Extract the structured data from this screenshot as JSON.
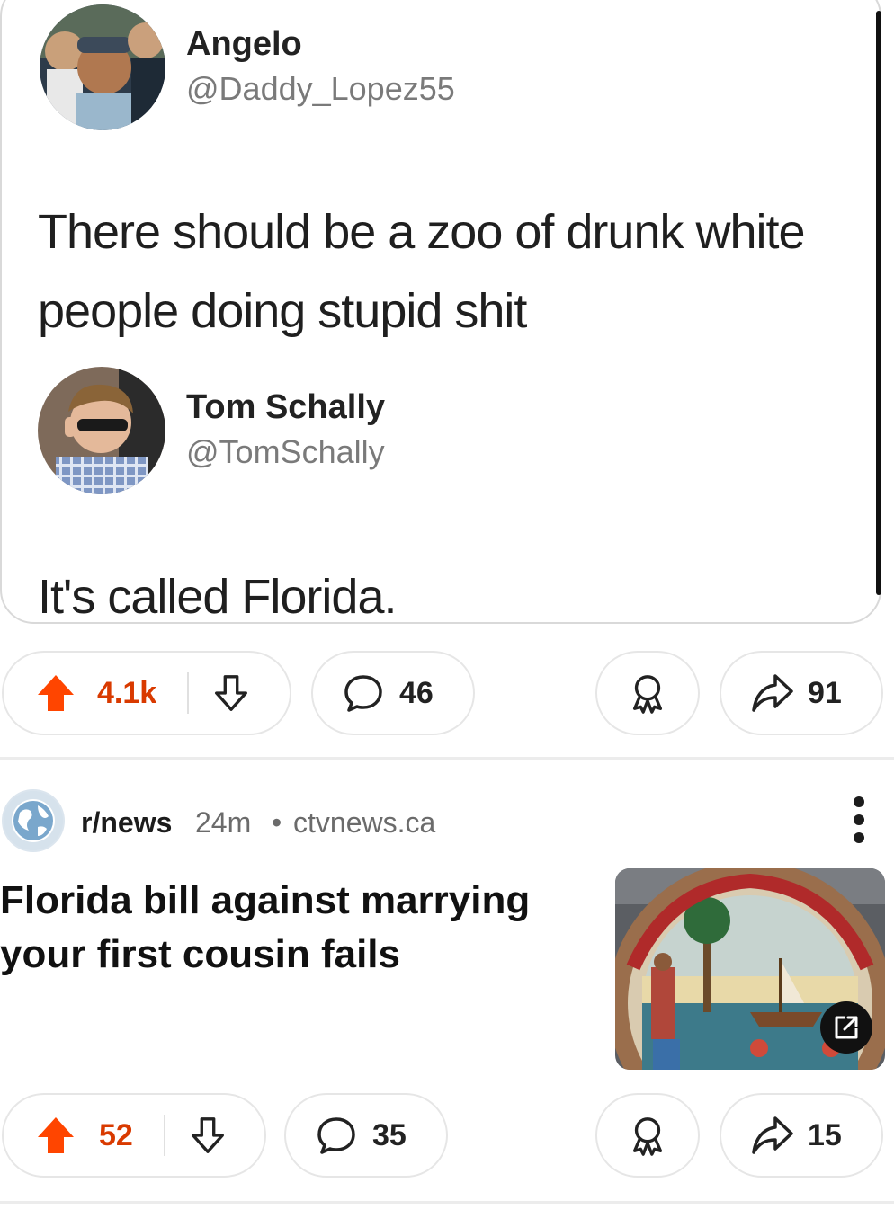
{
  "post1": {
    "tweet": {
      "author": {
        "name": "Angelo",
        "handle": "@Daddy_Lopez55"
      },
      "text_line1": "There should be a zoo of drunk white",
      "text_line2": "people doing stupid shit",
      "reply": {
        "name": "Tom Schally",
        "handle": "@TomSchally",
        "text": "It's called Florida."
      }
    },
    "actions": {
      "upvotes": "4.1k",
      "comments": "46",
      "shares": "91"
    }
  },
  "post2": {
    "subreddit": "r/news",
    "age": "24m",
    "dot": "•",
    "domain": "ctvnews.ca",
    "title_line1": "Florida bill against marrying",
    "title_line2": "your first cousin fails",
    "actions": {
      "upvotes": "52",
      "comments": "35",
      "shares": "15"
    }
  },
  "colors": {
    "upvote_active": "#ff4500",
    "upvote_count": "#d93a00",
    "border": "#e6e6e6"
  },
  "icons": [
    "upvote-arrow-icon",
    "downvote-arrow-icon",
    "comment-bubble-icon",
    "award-icon",
    "share-arrow-icon",
    "external-link-icon",
    "more-options-icon",
    "globe-icon"
  ]
}
